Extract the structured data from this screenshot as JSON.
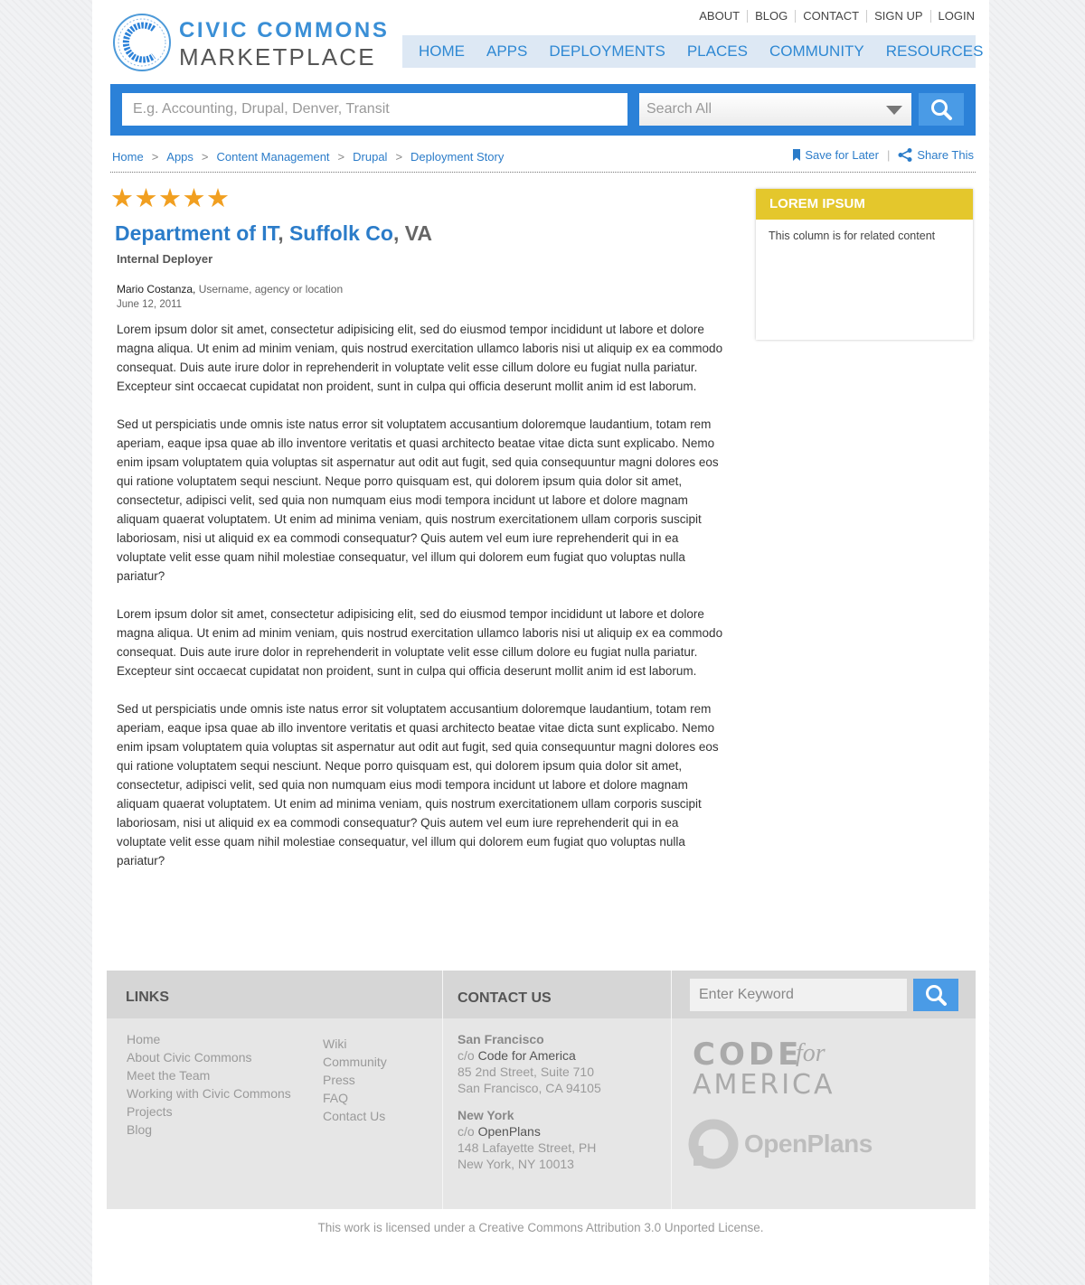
{
  "header": {
    "logo_line1": "CIVIC COMMONS",
    "logo_line2": "MARKETPLACE",
    "top_links": [
      "ABOUT",
      "BLOG",
      "CONTACT",
      "SIGN UP",
      "LOGIN"
    ],
    "nav": [
      "HOME",
      "APPS",
      "DEPLOYMENTS",
      "PLACES",
      "COMMUNITY",
      "RESOURCES"
    ]
  },
  "search": {
    "placeholder": "E.g. Accounting, Drupal, Denver, Transit",
    "scope": "Search All"
  },
  "breadcrumb": [
    "Home",
    "Apps",
    "Content Management",
    "Drupal",
    "Deployment Story"
  ],
  "actions": {
    "save": "Save for Later",
    "share": "Share This"
  },
  "article": {
    "rating": 5,
    "stars": [
      "★",
      "★",
      "★",
      "★",
      "★"
    ],
    "title_part1": "Department of IT",
    "title_sep1": ", ",
    "title_part2": "Suffolk Co",
    "title_sep2": ", VA",
    "subtitle": "Internal Deployer",
    "author": "Mario Costanza,",
    "author_meta": "Username, agency or location",
    "date": "June 12, 2011",
    "paragraphs": [
      "Lorem ipsum dolor sit amet, consectetur adipisicing elit, sed do eiusmod tempor incididunt ut labore et dolore magna aliqua. Ut enim ad minim veniam, quis nostrud exercitation ullamco laboris nisi ut aliquip ex ea commodo consequat. Duis aute irure dolor in reprehenderit in voluptate velit esse cillum dolore eu fugiat nulla pariatur. Excepteur sint occaecat cupidatat non proident, sunt in culpa qui officia deserunt mollit anim id est laborum.",
      "Sed ut perspiciatis unde omnis iste natus error sit voluptatem accusantium doloremque laudantium, totam rem aperiam, eaque ipsa quae ab illo inventore veritatis et quasi architecto beatae vitae dicta sunt explicabo. Nemo enim ipsam voluptatem quia voluptas sit aspernatur aut odit aut fugit, sed quia consequuntur magni dolores eos qui ratione voluptatem sequi nesciunt. Neque porro quisquam est, qui dolorem ipsum quia dolor sit amet, consectetur, adipisci velit, sed quia non numquam eius modi tempora incidunt ut labore et dolore magnam aliquam quaerat voluptatem. Ut enim ad minima veniam, quis nostrum exercitationem ullam corporis suscipit laboriosam, nisi ut aliquid ex ea commodi consequatur? Quis autem vel eum iure reprehenderit qui in ea voluptate velit esse quam nihil molestiae consequatur, vel illum qui dolorem eum fugiat quo voluptas nulla pariatur?",
      "Lorem ipsum dolor sit amet, consectetur adipisicing elit, sed do eiusmod tempor incididunt ut labore et dolore magna aliqua. Ut enim ad minim veniam, quis nostrud exercitation ullamco laboris nisi ut aliquip ex ea commodo consequat. Duis aute irure dolor in reprehenderit in voluptate velit esse cillum dolore eu fugiat nulla pariatur. Excepteur sint occaecat cupidatat non proident, sunt in culpa qui officia deserunt mollit anim id est laborum.",
      "Sed ut perspiciatis unde omnis iste natus error sit voluptatem accusantium doloremque laudantium, totam rem aperiam, eaque ipsa quae ab illo inventore veritatis et quasi architecto beatae vitae dicta sunt explicabo. Nemo enim ipsam voluptatem quia voluptas sit aspernatur aut odit aut fugit, sed quia consequuntur magni dolores eos qui ratione voluptatem sequi nesciunt. Neque porro quisquam est, qui dolorem ipsum quia dolor sit amet, consectetur, adipisci velit, sed quia non numquam eius modi tempora incidunt ut labore et dolore magnam aliquam quaerat voluptatem. Ut enim ad minima veniam, quis nostrum exercitationem ullam corporis suscipit laboriosam, nisi ut aliquid ex ea commodi consequatur? Quis autem vel eum iure reprehenderit qui in ea voluptate velit esse quam nihil molestiae consequatur, vel illum qui dolorem eum fugiat quo voluptas nulla pariatur?"
    ]
  },
  "sidebar": {
    "title": "LOREM IPSUM",
    "body": "This column is for related content"
  },
  "footer": {
    "links_heading": "LINKS",
    "links_col1": [
      "Home",
      "About Civic Commons",
      "Meet the Team",
      "Working with Civic Commons",
      "Projects",
      "Blog"
    ],
    "links_col2": [
      "Wiki",
      "Community",
      "Press",
      "FAQ",
      "Contact Us"
    ],
    "contact_heading": "CONTACT US",
    "sf": {
      "city": "San Francisco",
      "co": "c/o ",
      "org": "Code for America",
      "line1": "85 2nd Street, Suite 710",
      "line2": "San Francisco, CA 94105"
    },
    "ny": {
      "city": "New York",
      "co": "c/o ",
      "org": "OpenPlans",
      "line1": "148 Lafayette Street, PH",
      "line2": "New York, NY 10013"
    },
    "search_placeholder": "Enter Keyword",
    "cfa_code": "CODE",
    "cfa_for": "for",
    "cfa_america": "AMERICA",
    "openplans": "OpenPlans"
  },
  "license": "This work is licensed under a Creative Commons Attribution 3.0 Unported License.",
  "colors": {
    "brand_blue": "#2b81d8",
    "link_blue": "#2b7cc9",
    "star_orange": "#f19f20",
    "sidebar_yellow": "#e4c72c",
    "footer_grey": "#e6e6e6"
  },
  "icons": {
    "logo": "civic-commons-c-logo",
    "search": "magnifier-icon",
    "save": "bookmark-icon",
    "share": "share-icon",
    "dropdown": "caret-down-icon",
    "openplans": "openplans-p-icon"
  }
}
